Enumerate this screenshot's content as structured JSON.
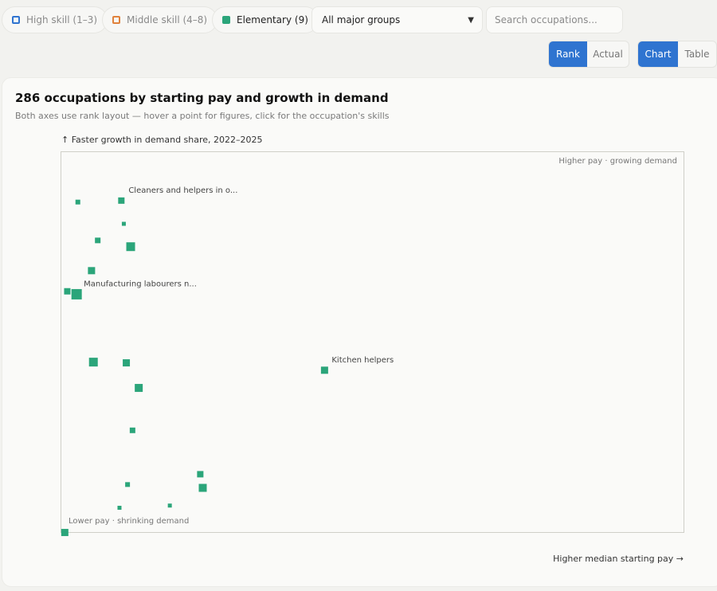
{
  "filters": {
    "high": {
      "label": "High skill (1–3)",
      "color": "#2f74d0",
      "active": false
    },
    "middle": {
      "label": "Middle skill (4–8)",
      "color": "#e0823c",
      "active": false
    },
    "elementary": {
      "label": "Elementary (9)",
      "color": "#2ba57a",
      "active": true
    },
    "group_select": "All major groups",
    "search_placeholder": "Search occupations..."
  },
  "toggles": {
    "scale": [
      "Rank",
      "Actual"
    ],
    "scale_active": "Rank",
    "view": [
      "Chart",
      "Table"
    ],
    "view_active": "Chart"
  },
  "chart": {
    "title": "286 occupations by starting pay and growth in demand",
    "subtitle": "Both axes use rank layout — hover a point for figures, click for the occupation's skills",
    "ylabel": "↑ Faster growth in demand share, 2022–2025",
    "xlabel": "Higher median starting pay →",
    "corner_top_right": "Higher pay · growing demand",
    "corner_bottom_left": "Lower pay · shrinking demand"
  },
  "chart_data": {
    "type": "scatter",
    "title": "286 occupations by starting pay and growth in demand",
    "xlabel": "Higher median starting pay →",
    "ylabel": "↑ Faster growth in demand share, 2022–2025",
    "scale": "rank",
    "xlim": [
      0,
      1
    ],
    "ylim": [
      0,
      1
    ],
    "grid": false,
    "point_color": "#2ba57a",
    "points": [
      {
        "x": 0.024,
        "y": 0.897,
        "s": 6,
        "label": ""
      },
      {
        "x": 0.094,
        "y": 0.901,
        "s": 8,
        "label": "Cleaners and helpers in o..."
      },
      {
        "x": 0.098,
        "y": 0.838,
        "s": 5,
        "label": ""
      },
      {
        "x": 0.056,
        "y": 0.793,
        "s": 7,
        "label": ""
      },
      {
        "x": 0.109,
        "y": 0.776,
        "s": 11,
        "label": ""
      },
      {
        "x": 0.046,
        "y": 0.711,
        "s": 9,
        "label": ""
      },
      {
        "x": 0.007,
        "y": 0.655,
        "s": 8,
        "label": ""
      },
      {
        "x": 0.022,
        "y": 0.647,
        "s": 13,
        "label": "Manufacturing labourers n..."
      },
      {
        "x": 0.049,
        "y": 0.463,
        "s": 11,
        "label": ""
      },
      {
        "x": 0.102,
        "y": 0.461,
        "s": 9,
        "label": ""
      },
      {
        "x": 0.421,
        "y": 0.441,
        "s": 9,
        "label": "Kitchen helpers"
      },
      {
        "x": 0.122,
        "y": 0.393,
        "s": 10,
        "label": ""
      },
      {
        "x": 0.112,
        "y": 0.278,
        "s": 7,
        "label": ""
      },
      {
        "x": 0.221,
        "y": 0.159,
        "s": 8,
        "label": ""
      },
      {
        "x": 0.104,
        "y": 0.131,
        "s": 6,
        "label": ""
      },
      {
        "x": 0.225,
        "y": 0.122,
        "s": 10,
        "label": ""
      },
      {
        "x": 0.172,
        "y": 0.074,
        "s": 5,
        "label": ""
      },
      {
        "x": 0.091,
        "y": 0.068,
        "s": 5,
        "label": ""
      },
      {
        "x": 0.003,
        "y": 0.001,
        "s": 9,
        "label": ""
      }
    ]
  }
}
